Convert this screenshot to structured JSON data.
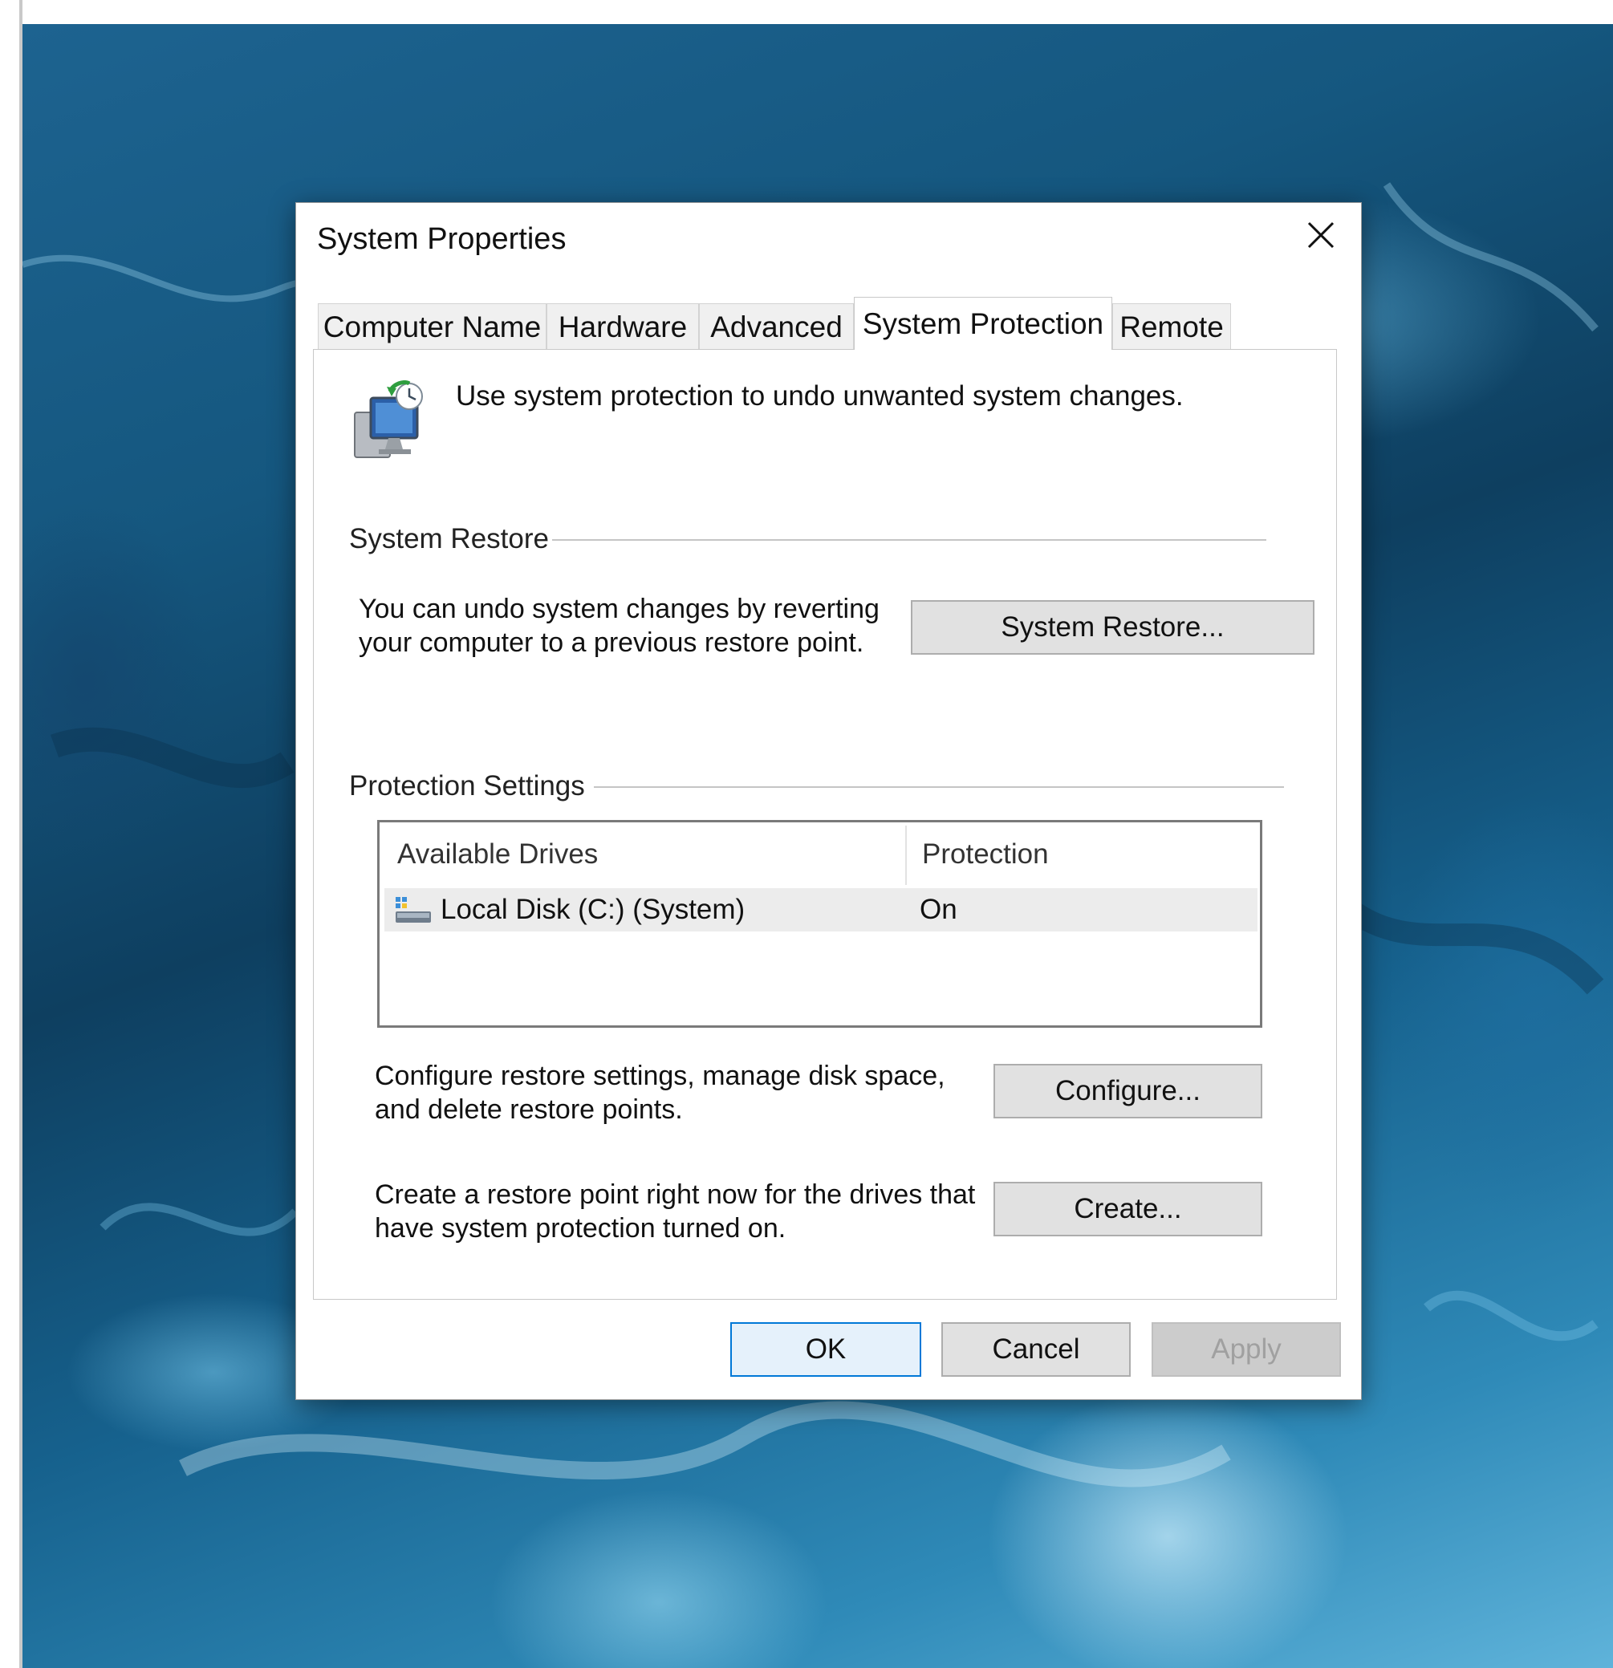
{
  "window": {
    "title": "System Properties"
  },
  "tabs": [
    {
      "label": "Computer Name",
      "active": false
    },
    {
      "label": "Hardware",
      "active": false
    },
    {
      "label": "Advanced",
      "active": false
    },
    {
      "label": "System Protection",
      "active": true
    },
    {
      "label": "Remote",
      "active": false
    }
  ],
  "header": {
    "text": "Use system protection to undo unwanted system changes.",
    "icon": "system-protection-icon"
  },
  "system_restore": {
    "section_label": "System Restore",
    "description_line1": "You can undo system changes by reverting",
    "description_line2": "your computer to a previous restore point.",
    "button_label": "System Restore..."
  },
  "protection_settings": {
    "section_label": "Protection Settings",
    "columns": [
      "Available Drives",
      "Protection"
    ],
    "rows": [
      {
        "drive": "Local Disk (C:) (System)",
        "protection": "On",
        "icon": "drive-icon"
      }
    ],
    "configure_text_line1": "Configure restore settings, manage disk space,",
    "configure_text_line2": "and delete restore points.",
    "configure_button": "Configure...",
    "create_text_line1": "Create a restore point right now for the drives that",
    "create_text_line2": "have system protection turned on.",
    "create_button": "Create..."
  },
  "footer": {
    "ok": "OK",
    "cancel": "Cancel",
    "apply": "Apply"
  },
  "colors": {
    "accent_border": "#0078d7",
    "button_face": "#e1e1e1",
    "disabled_text": "#a0a0a0"
  }
}
